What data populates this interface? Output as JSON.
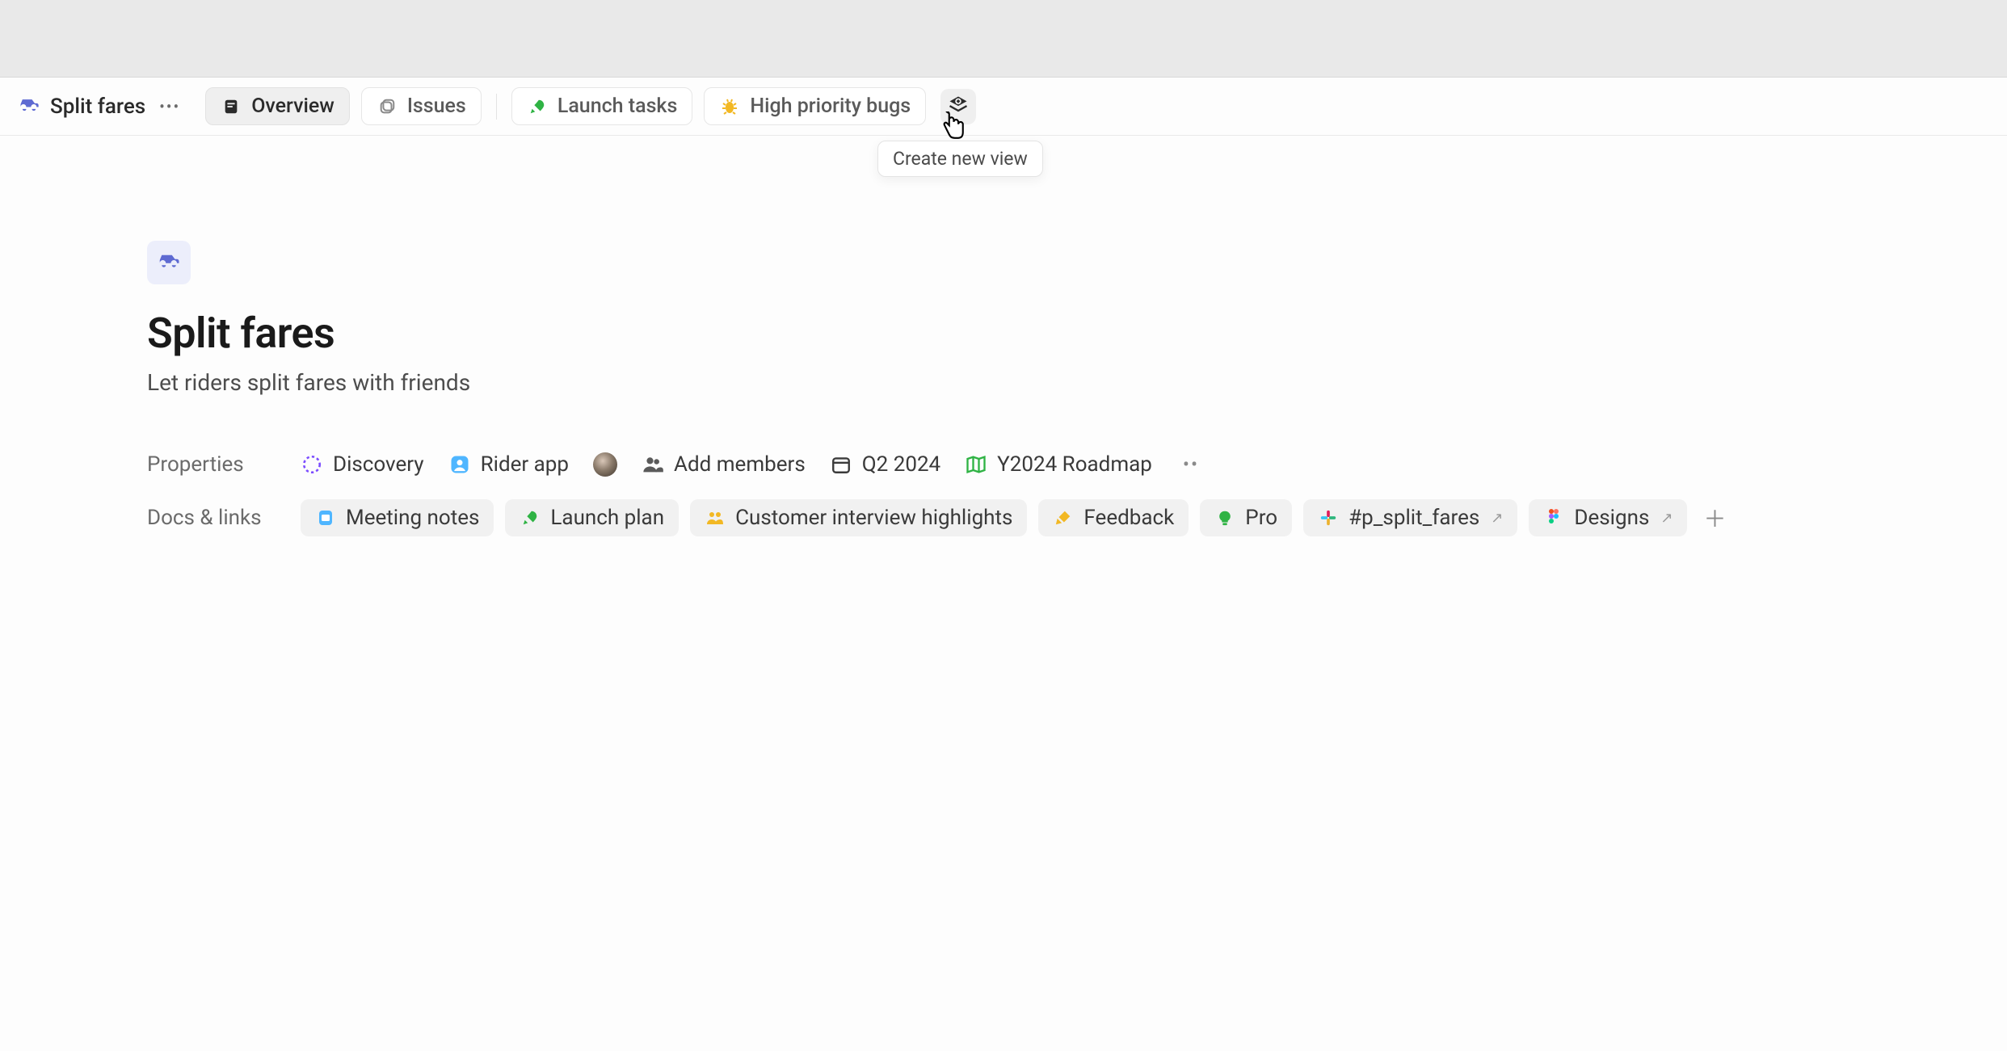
{
  "breadcrumb": {
    "title": "Split fares"
  },
  "tabs": {
    "overview": "Overview",
    "issues": "Issues",
    "launch_tasks": "Launch tasks",
    "high_priority_bugs": "High priority bugs"
  },
  "tooltip": {
    "create_view": "Create new view"
  },
  "project": {
    "title": "Split fares",
    "description": "Let riders split fares with friends"
  },
  "labels": {
    "properties": "Properties",
    "docs_links": "Docs & links"
  },
  "properties": {
    "status": "Discovery",
    "team": "Rider app",
    "add_members": "Add members",
    "target": "Q2 2024",
    "roadmap": "Y2024 Roadmap"
  },
  "docs": {
    "meeting_notes": "Meeting notes",
    "launch_plan": "Launch plan",
    "customer_interviews": "Customer interview highlights",
    "feedback": "Feedback",
    "product_truncated": "Pro",
    "slack_channel": "#p_split_fares",
    "designs": "Designs"
  }
}
